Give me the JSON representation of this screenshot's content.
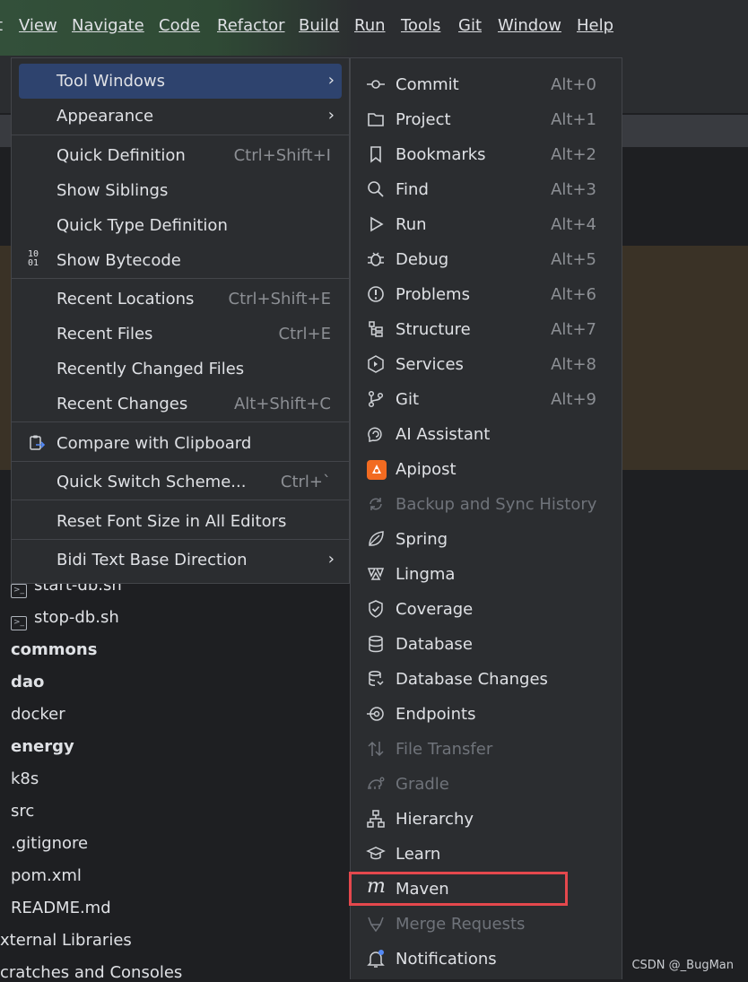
{
  "menubar": [
    "t",
    "View",
    "Navigate",
    "Code",
    "Refactor",
    "Build",
    "Run",
    "Tools",
    "Git",
    "Window",
    "Help"
  ],
  "tree": {
    "items": [
      {
        "label": "start-db.sh",
        "bold": false
      },
      {
        "label": "stop-db.sh",
        "bold": false
      },
      {
        "label": "commons",
        "bold": true
      },
      {
        "label": "dao",
        "bold": true
      },
      {
        "label": "docker",
        "bold": false
      },
      {
        "label": "energy",
        "bold": true
      },
      {
        "label": "k8s",
        "bold": false
      },
      {
        "label": "src",
        "bold": false
      },
      {
        "label": ".gitignore",
        "bold": false
      },
      {
        "label": "pom.xml",
        "bold": false
      },
      {
        "label": "README.md",
        "bold": false
      },
      {
        "label": "xternal Libraries",
        "bold": false
      },
      {
        "label": "cratches and Consoles",
        "bold": false
      }
    ]
  },
  "view_menu": {
    "items": [
      {
        "label": "Tool Windows",
        "shortcut": "",
        "submenu": true,
        "highlighted": true
      },
      {
        "label": "Appearance",
        "shortcut": "",
        "submenu": true
      },
      {
        "label": "Quick Definition",
        "shortcut": "Ctrl+Shift+I"
      },
      {
        "label": "Show Siblings",
        "shortcut": ""
      },
      {
        "label": "Quick Type Definition",
        "shortcut": ""
      },
      {
        "label": "Show Bytecode",
        "shortcut": "",
        "icon": "bytecode-icon"
      },
      {
        "label": "Recent Locations",
        "shortcut": "Ctrl+Shift+E"
      },
      {
        "label": "Recent Files",
        "shortcut": "Ctrl+E"
      },
      {
        "label": "Recently Changed Files",
        "shortcut": ""
      },
      {
        "label": "Recent Changes",
        "shortcut": "Alt+Shift+C"
      },
      {
        "label": "Compare with Clipboard",
        "shortcut": "",
        "icon": "clipboard-compare-icon"
      },
      {
        "label": "Quick Switch Scheme...",
        "shortcut": "Ctrl+`"
      },
      {
        "label": "Reset Font Size in All Editors",
        "shortcut": ""
      },
      {
        "label": "Bidi Text Base Direction",
        "shortcut": "",
        "submenu": true
      }
    ]
  },
  "tool_windows": {
    "items": [
      {
        "label": "Commit",
        "shortcut": "Alt+0",
        "icon": "commit-icon"
      },
      {
        "label": "Project",
        "shortcut": "Alt+1",
        "icon": "folder-icon"
      },
      {
        "label": "Bookmarks",
        "shortcut": "Alt+2",
        "icon": "bookmark-icon"
      },
      {
        "label": "Find",
        "shortcut": "Alt+3",
        "icon": "search-icon"
      },
      {
        "label": "Run",
        "shortcut": "Alt+4",
        "icon": "run-icon"
      },
      {
        "label": "Debug",
        "shortcut": "Alt+5",
        "icon": "debug-icon"
      },
      {
        "label": "Problems",
        "shortcut": "Alt+6",
        "icon": "problems-icon"
      },
      {
        "label": "Structure",
        "shortcut": "Alt+7",
        "icon": "structure-icon"
      },
      {
        "label": "Services",
        "shortcut": "Alt+8",
        "icon": "services-icon"
      },
      {
        "label": "Git",
        "shortcut": "Alt+9",
        "icon": "git-icon"
      },
      {
        "label": "AI Assistant",
        "shortcut": "",
        "icon": "ai-assistant-icon"
      },
      {
        "label": "Apipost",
        "shortcut": "",
        "icon": "apipost-icon"
      },
      {
        "label": "Backup and Sync History",
        "shortcut": "",
        "icon": "sync-icon",
        "disabled": true
      },
      {
        "label": "Spring",
        "shortcut": "",
        "icon": "spring-icon"
      },
      {
        "label": "Lingma",
        "shortcut": "",
        "icon": "lingma-icon"
      },
      {
        "label": "Coverage",
        "shortcut": "",
        "icon": "coverage-icon"
      },
      {
        "label": "Database",
        "shortcut": "",
        "icon": "database-icon"
      },
      {
        "label": "Database Changes",
        "shortcut": "",
        "icon": "database-changes-icon"
      },
      {
        "label": "Endpoints",
        "shortcut": "",
        "icon": "endpoints-icon"
      },
      {
        "label": "File Transfer",
        "shortcut": "",
        "icon": "file-transfer-icon",
        "disabled": true
      },
      {
        "label": "Gradle",
        "shortcut": "",
        "icon": "gradle-icon",
        "disabled": true
      },
      {
        "label": "Hierarchy",
        "shortcut": "",
        "icon": "hierarchy-icon"
      },
      {
        "label": "Learn",
        "shortcut": "",
        "icon": "learn-icon"
      },
      {
        "label": "Maven",
        "shortcut": "",
        "icon": "maven-icon"
      },
      {
        "label": "Merge Requests",
        "shortcut": "",
        "icon": "merge-requests-icon",
        "disabled": true
      },
      {
        "label": "Notifications",
        "shortcut": "",
        "icon": "notifications-icon"
      }
    ]
  },
  "watermark": "CSDN @_BugMan",
  "colors": {
    "menu_bg": "#2b2d30",
    "highlight": "#2e436e",
    "annotation": "#e5484d",
    "accent_orange": "#f26b21"
  }
}
